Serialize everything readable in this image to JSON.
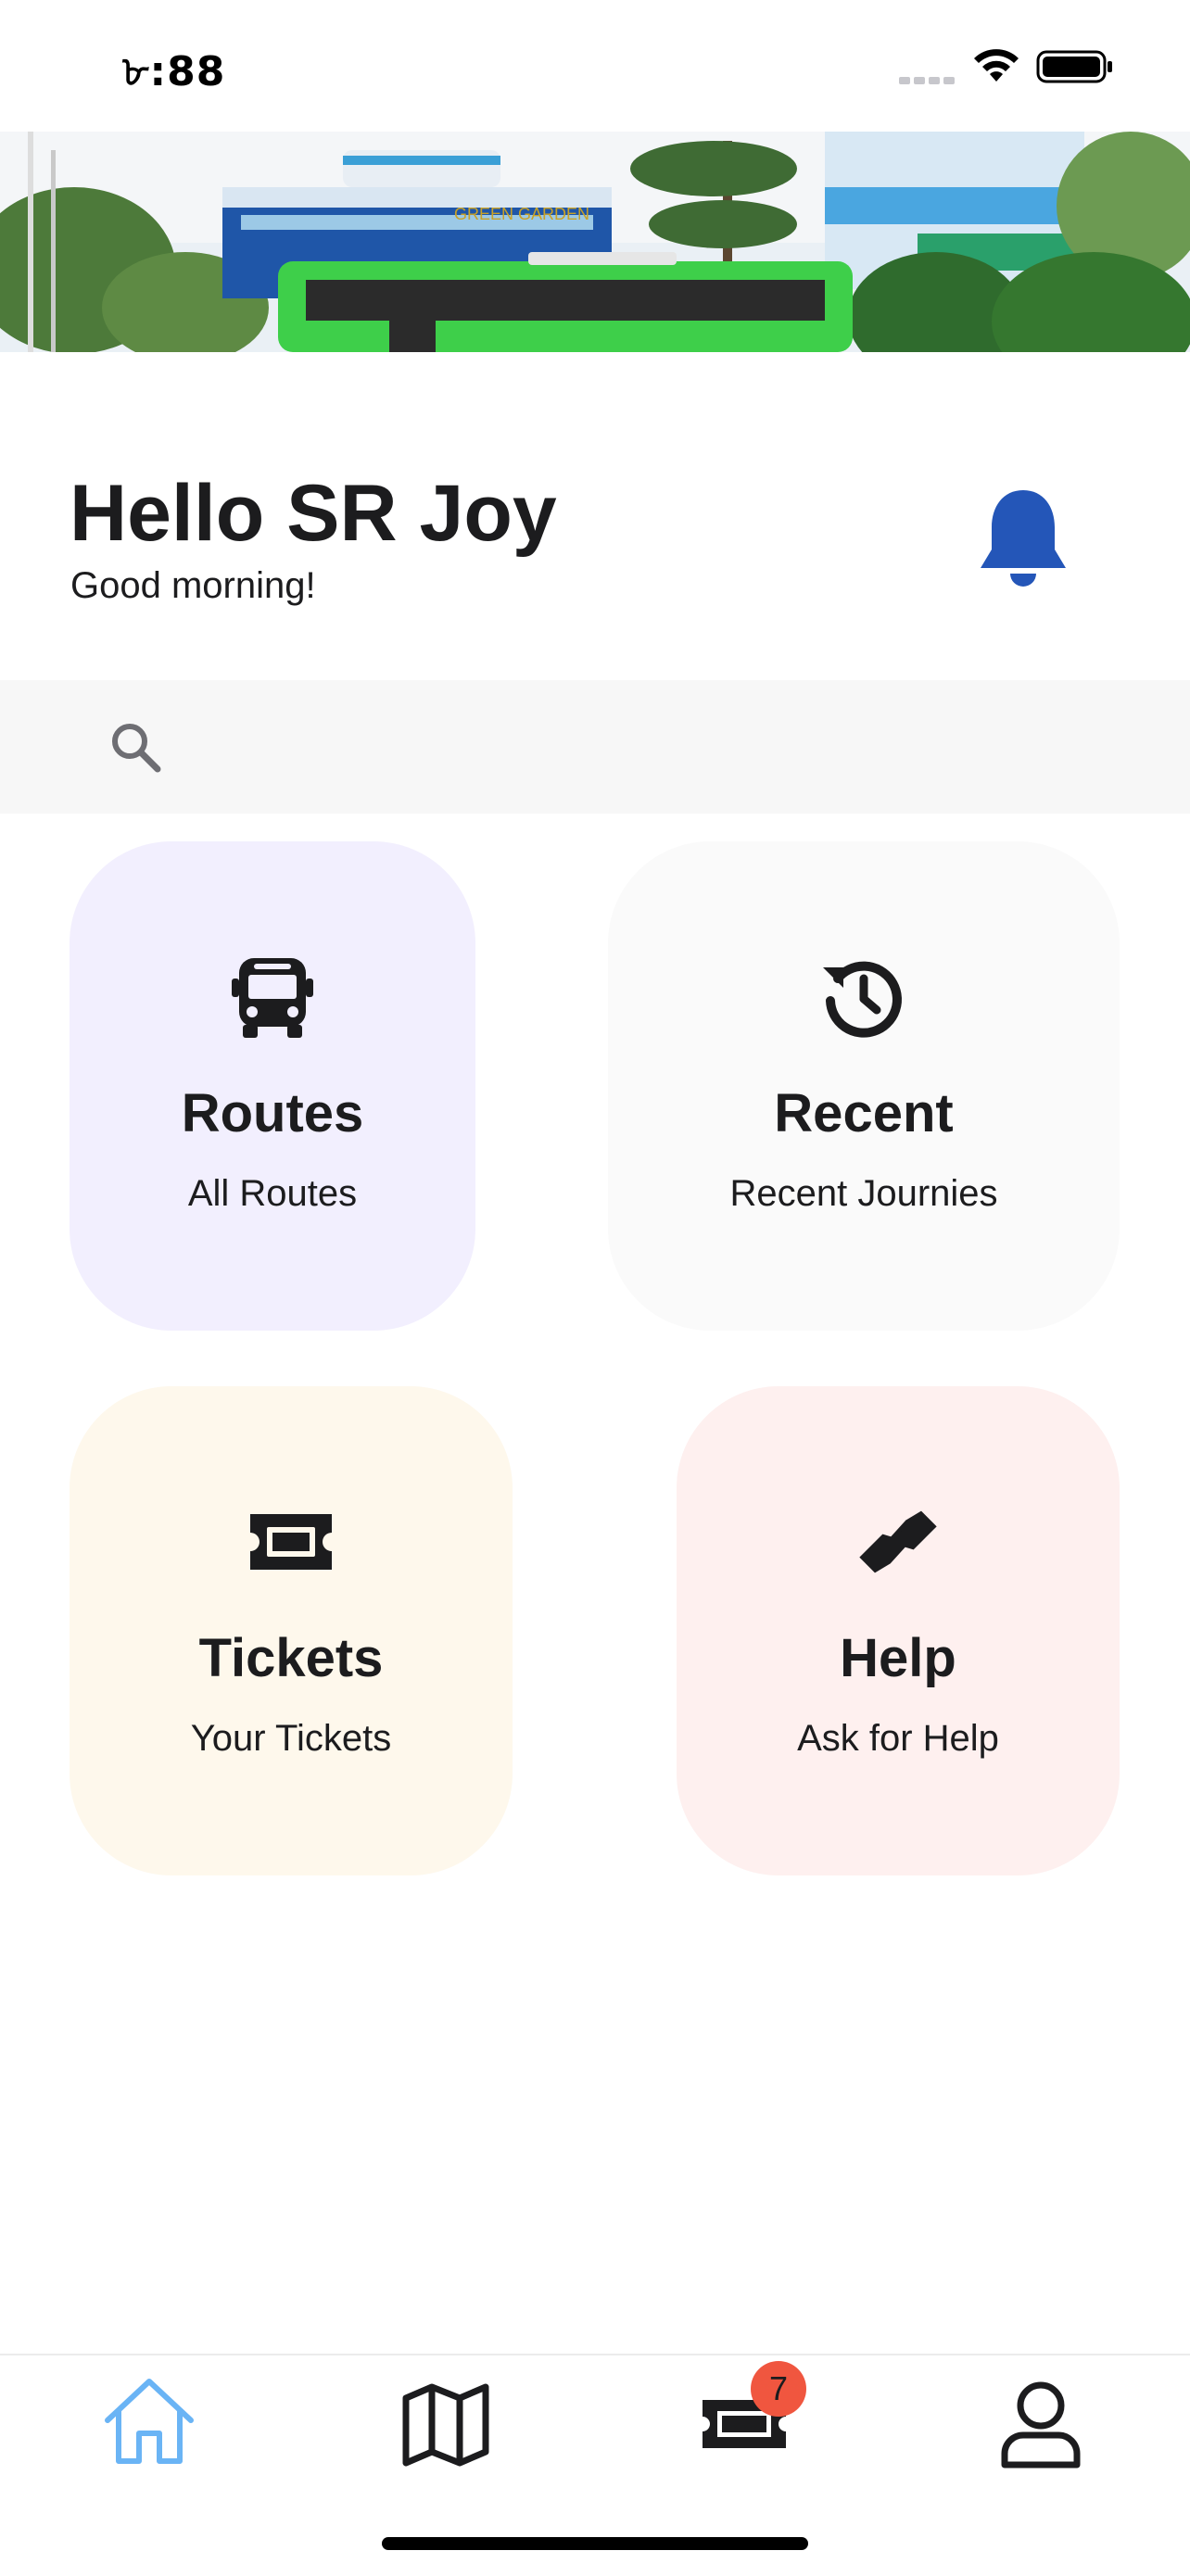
{
  "status_bar": {
    "time": "৮:88"
  },
  "banner": {
    "sign_text": "GREEN GARDEN"
  },
  "header": {
    "greeting": "Hello SR Joy",
    "subgreeting": "Good morning!",
    "notification_icon": "bell-icon"
  },
  "search": {
    "icon": "search-icon",
    "placeholder": "",
    "value": ""
  },
  "cards": [
    {
      "icon": "bus-icon",
      "title": "Routes",
      "subtitle": "All Routes",
      "color": "#f2effe"
    },
    {
      "icon": "history-icon",
      "title": "Recent",
      "subtitle": "Recent Journies",
      "color": "#fafafa"
    },
    {
      "icon": "ticket-icon",
      "title": "Tickets",
      "subtitle": "Your Tickets",
      "color": "#fef8ec"
    },
    {
      "icon": "handshake-icon",
      "title": "Help",
      "subtitle": "Ask for Help",
      "color": "#fef0ef"
    }
  ],
  "bottom_nav": {
    "items": [
      {
        "icon": "home-icon",
        "active": true
      },
      {
        "icon": "map-icon",
        "active": false
      },
      {
        "icon": "ticket-icon",
        "active": false,
        "badge": "7"
      },
      {
        "icon": "profile-icon",
        "active": false
      }
    ],
    "active_color": "#6ab4f5",
    "badge_color": "#f0563f"
  },
  "colors": {
    "bell": "#2456b8",
    "text": "#1c1c1e"
  }
}
